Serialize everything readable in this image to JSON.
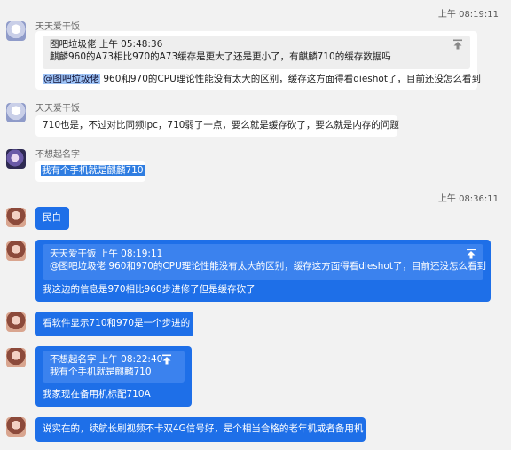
{
  "timestamps": [
    "上午 08:19:11",
    "上午 08:36:11"
  ],
  "messages": {
    "m1": {
      "sender": "天天爱干饭",
      "quote_header": "图吧垃圾佬   上午 05:48:36",
      "quote_text": "麒麟960的A73相比970的A73缓存是更大了还是更小了，有麒麟710的缓存数据吗",
      "mention": "@图吧垃圾佬",
      "text": " 960和970的CPU理论性能没有太大的区别，缓存这方面得看dieshot了，目前还没怎么看到"
    },
    "m2": {
      "sender": "天天爱干饭",
      "text": "710也是，不过对比同频ipc，710弱了一点，要么就是缓存砍了，要么就是内存的问题"
    },
    "m3": {
      "sender": "不想起名字",
      "text": "我有个手机就是麒麟710"
    },
    "m4": {
      "text": "民白"
    },
    "m5": {
      "quote_header": "天天爱干饭   上午 08:19:11",
      "quote_text": "@图吧垃圾佬 960和970的CPU理论性能没有太大的区别，缓存这方面得看dieshot了，目前还没怎么看到",
      "text": "我这边的信息是970相比960步进修了但是缓存砍了"
    },
    "m6": {
      "text": "看软件显示710和970是一个步进的"
    },
    "m7": {
      "quote_header": "不想起名字   上午 08:22:40",
      "quote_text": "我有个手机就是麒麟710",
      "text": "我家现在备用机标配710A"
    },
    "m8": {
      "text": "说实在的，续航长刷视频不卡双4G信号好，是个相当合格的老年机或者备用机"
    }
  },
  "colors": {
    "blue_bubble": "#1e6fe8",
    "background": "#f2f2f2"
  },
  "icons": {
    "quote_jump": "arrow-up-bar-icon"
  }
}
